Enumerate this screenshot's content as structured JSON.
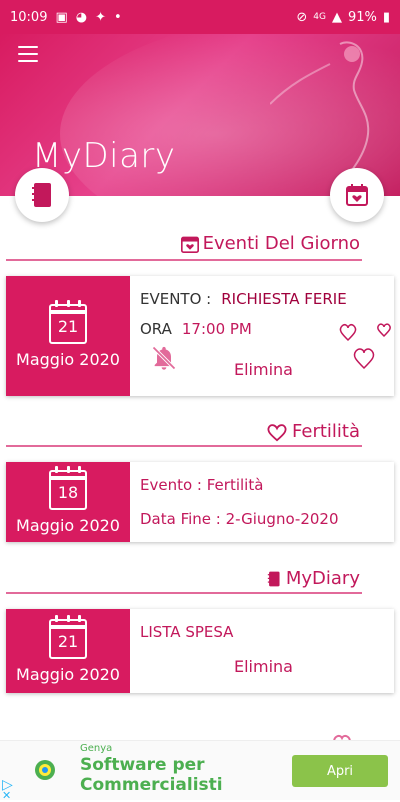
{
  "status_bar": {
    "time": "10:09",
    "battery": "91%",
    "network": "4G"
  },
  "header": {
    "title": "MyDiary"
  },
  "sections": [
    {
      "title": "Eventi Del Giorno"
    },
    {
      "title": "Fertilità"
    },
    {
      "title": "MyDiary"
    }
  ],
  "cards": [
    {
      "day": "21",
      "month": "Maggio 2020",
      "line1_label": "EVENTO :",
      "line1_value": "RICHIESTA FERIE",
      "line2_label": "ORA",
      "line2_value": "17:00 PM",
      "action": "Elimina"
    },
    {
      "day": "18",
      "month": "Maggio  2020",
      "line1": "Evento : Fertilità",
      "line2": "Data Fine : 2-Giugno-2020"
    },
    {
      "day": "21",
      "month": "Maggio 2020",
      "line1": "LISTA SPESA",
      "action": "Elimina"
    }
  ],
  "ad": {
    "advertiser": "Genya",
    "headline": "Software per Commercialisti",
    "button": "Apri"
  },
  "colors": {
    "primary": "#d81b60",
    "text_accent": "#c2185b",
    "ad_green": "#4caf50",
    "ad_button": "#8bc34a"
  }
}
